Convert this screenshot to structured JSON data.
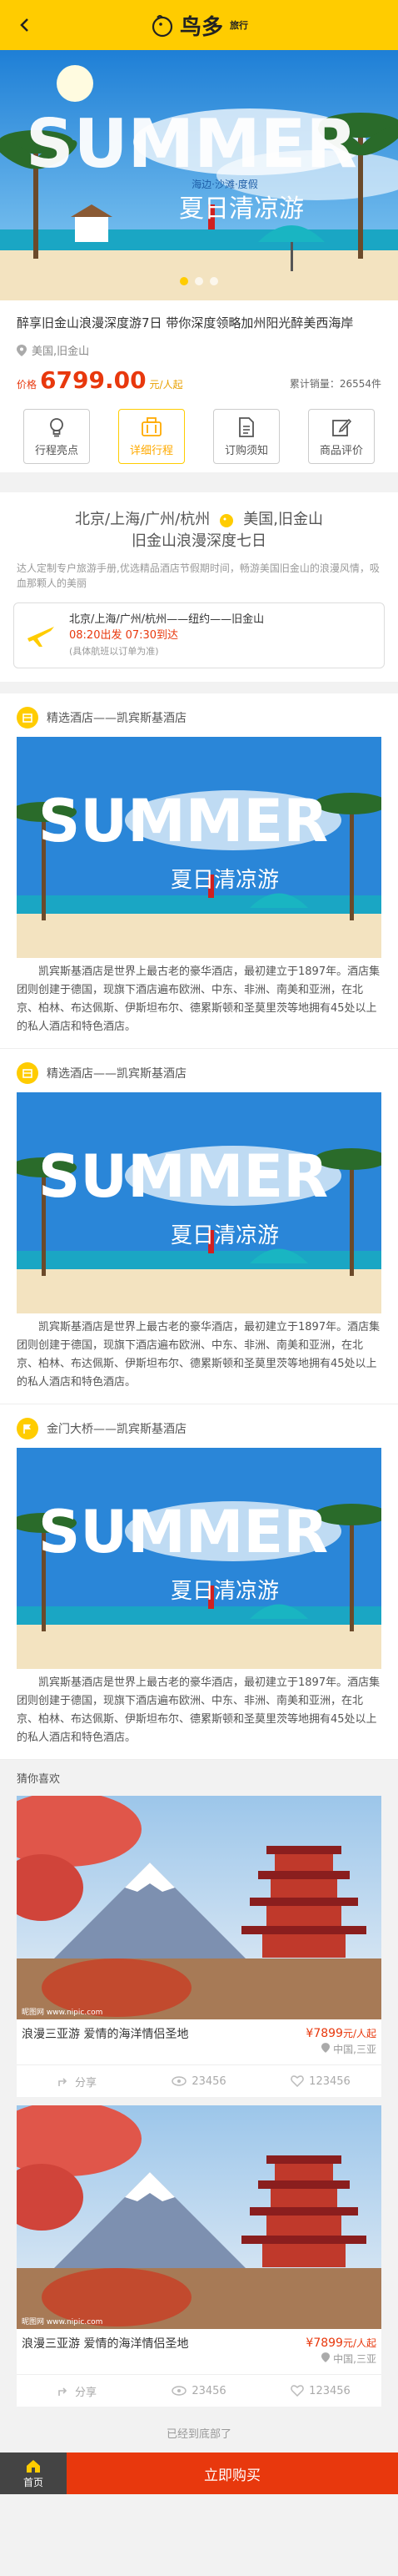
{
  "header": {
    "logo_main": "鸟多",
    "logo_sub": "旅行",
    "accent": "#ffcc00"
  },
  "hero": {
    "headline": "SUMMER",
    "script": "海边·沙滩·度假",
    "subtitle": "夏日清凉游",
    "slides": 3,
    "active_slide": 0
  },
  "product": {
    "title": "醉享旧金山浪漫深度游7日 带你深度领略加州阳光醉美西海岸",
    "location": "美国,旧金山",
    "price_prefix": "价格",
    "price": "6799.00",
    "price_unit": "元/人起",
    "sold": "累计销量：26554件",
    "tabs": [
      {
        "label": "行程亮点",
        "icon": "bulb-icon"
      },
      {
        "label": "详细行程",
        "icon": "suitcase-icon"
      },
      {
        "label": "订购须知",
        "icon": "document-icon"
      },
      {
        "label": "商品评价",
        "icon": "edit-icon"
      }
    ],
    "active_tab": 1
  },
  "itinerary": {
    "from": "北京/上海/广州/杭州",
    "to": "美国,旧金山",
    "line2": "旧金山浪漫深度七日",
    "desc": "达人定制专户旅游手册,优选精品酒店节假期时间，畅游美国旧金山的浪漫风情，吸血那颗人的美丽",
    "flight_route": "北京/上海/广州/杭州——纽约——旧金山",
    "flight_time": "08:20出发   07:30到达",
    "flight_note": "(具体航班以订单为准)"
  },
  "sections": [
    {
      "icon": "hotel-icon",
      "title": "精选酒店——凯宾斯基酒店",
      "text": "凯宾斯基酒店是世界上最古老的豪华酒店，最初建立于1897年。酒店集团则创建于德国，现旗下酒店遍布欧洲、中东、非洲、南美和亚洲，在北京、柏林、布达佩斯、伊斯坦布尔、德累斯顿和圣莫里茨等地拥有45处以上的私人酒店和特色酒店。"
    },
    {
      "icon": "hotel-icon",
      "title": "精选酒店——凯宾斯基酒店",
      "text": "凯宾斯基酒店是世界上最古老的豪华酒店，最初建立于1897年。酒店集团则创建于德国，现旗下酒店遍布欧洲、中东、非洲、南美和亚洲，在北京、柏林、布达佩斯、伊斯坦布尔、德累斯顿和圣莫里茨等地拥有45处以上的私人酒店和特色酒店。"
    },
    {
      "icon": "flag-icon",
      "title": "金门大桥——凯宾斯基酒店",
      "text": "凯宾斯基酒店是世界上最古老的豪华酒店，最初建立于1897年。酒店集团则创建于德国，现旗下酒店遍布欧洲、中东、非洲、南美和亚洲，在北京、柏林、布达佩斯、伊斯坦布尔、德累斯顿和圣莫里茨等地拥有45处以上的私人酒店和特色酒店。"
    }
  ],
  "guess": {
    "title": "猜你喜欢",
    "cards": [
      {
        "name": "浪漫三亚游 爱情的海洋情侣圣地",
        "price": "¥7899",
        "price_unit": "元/人起",
        "location": "中国,三亚",
        "shares": "分享",
        "views": "23456",
        "likes": "123456",
        "watermark": "昵图网 www.nipic.com"
      },
      {
        "name": "浪漫三亚游 爱情的海洋情侣圣地",
        "price": "¥7899",
        "price_unit": "元/人起",
        "location": "中国,三亚",
        "shares": "分享",
        "views": "23456",
        "likes": "123456",
        "watermark": "昵图网 www.nipic.com"
      }
    ],
    "end_text": "已经到底部了"
  },
  "bottom": {
    "home": "首页",
    "buy": "立即购买"
  }
}
